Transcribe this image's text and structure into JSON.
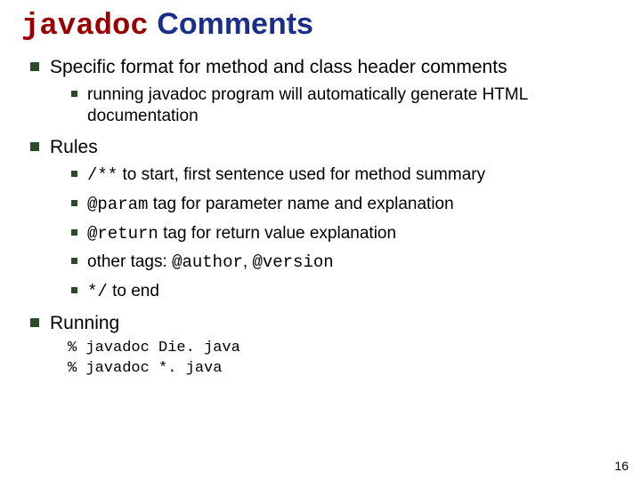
{
  "title": {
    "code": "javadoc",
    "rest": " Comments"
  },
  "b1": {
    "text": "Specific format for method and class header comments",
    "sub1": "running javadoc program will automatically generate HTML documentation"
  },
  "b2": {
    "text": "Rules",
    "s1a": "/**",
    "s1b": " to start, first sentence used for method summary",
    "s2a": "@param",
    "s2b": " tag for parameter name and explanation",
    "s3a": "@return",
    "s3b": " tag for return value explanation",
    "s4a": "other tags: ",
    "s4b": "@author",
    "s4c": ", ",
    "s4d": "@version",
    "s5a": "*/",
    "s5b": " to end"
  },
  "b3": {
    "text": "Running",
    "code": "% javadoc Die. java\n% javadoc *. java"
  },
  "page": "16"
}
